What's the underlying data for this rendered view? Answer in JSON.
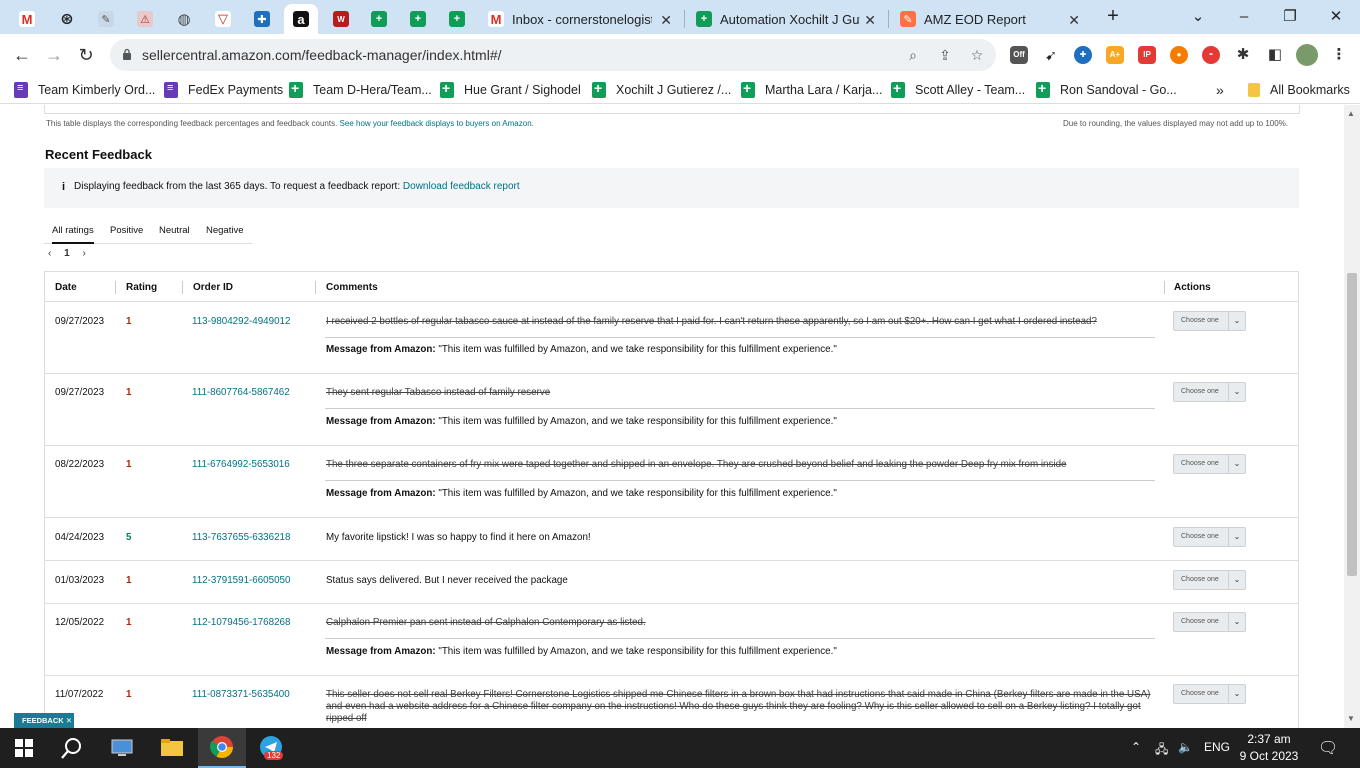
{
  "browser": {
    "tabs": [
      {
        "title": "Inbox - cornerstonelogisti"
      },
      {
        "title": "Automation Xochilt J Gutie"
      },
      {
        "title": "AMZ EOD Report"
      }
    ],
    "url": "sellercentral.amazon.com/feedback-manager/index.html#/",
    "new_tab": "+",
    "win_min": "–",
    "win_max": "❐",
    "win_close": "✕",
    "chevron": "⌄",
    "ext_off_label": "Off"
  },
  "bookmarks": {
    "items": [
      {
        "label": "Team Kimberly Ord..."
      },
      {
        "label": "FedEx Payments"
      },
      {
        "label": "Team D-Hera/Team..."
      },
      {
        "label": "Hue Grant / Sighodel"
      },
      {
        "label": "Xochilt J Gutierez /..."
      },
      {
        "label": "Martha Lara / Karja..."
      },
      {
        "label": "Scott Alley - Team..."
      },
      {
        "label": "Ron Sandoval - Go..."
      }
    ],
    "more": "»",
    "all_bookmarks": "All Bookmarks"
  },
  "page": {
    "table_note": "This table displays the corresponding feedback percentages and feedback counts.",
    "table_note_link": "See how your feedback displays to buyers on Amazon.",
    "rounding_note": "Due to rounding, the values displayed may not add up to 100%.",
    "section_title": "Recent Feedback",
    "info_icon": "i",
    "info_text": "Displaying feedback from the last 365 days. To request a feedback report:",
    "info_link": "Download feedback report",
    "rating_tabs": [
      "All ratings",
      "Positive",
      "Neutral",
      "Negative"
    ],
    "pager": {
      "prev": "‹",
      "page": "1",
      "next": "›"
    },
    "columns": [
      "Date",
      "Rating",
      "Order ID",
      "Comments",
      "Actions"
    ],
    "message_prefix": "Message from Amazon:",
    "message_text": "\"This item was fulfilled by Amazon, and we take responsibility for this fulfillment experience.\"",
    "action_label": "Choose one",
    "rows": [
      {
        "date": "09/27/2023",
        "rating": "1",
        "order": "113-9804292-4949012",
        "comment": "I received 2 bottles of regular tabasco sauce at instead of the family reserve that I paid for. I can't return these apparently, so I am out $20+. How can I get what I ordered instead?"
      },
      {
        "date": "09/27/2023",
        "rating": "1",
        "order": "111-8607764-5867462",
        "comment": "They sent regular Tabasco instead of family reserve"
      },
      {
        "date": "08/22/2023",
        "rating": "1",
        "order": "111-6764992-5653016",
        "comment": "The three separate containers of fry mix were taped together and shipped in an envelope. They are crushed beyond belief and leaking the powder Deep fry mix from inside"
      },
      {
        "date": "04/24/2023",
        "rating": "5",
        "order": "113-7637655-6336218",
        "comment": "My favorite lipstick! I was so happy to find it here on Amazon!"
      },
      {
        "date": "01/03/2023",
        "rating": "1",
        "order": "112-3791591-6605050",
        "comment": "Status says delivered. But I never received the package"
      },
      {
        "date": "12/05/2022",
        "rating": "1",
        "order": "112-1079456-1768268",
        "comment": "Calphalon Premier pan sent instead of Calphalon Contemporary as listed."
      },
      {
        "date": "11/07/2022",
        "rating": "1",
        "order": "111-0873371-5635400",
        "comment": "This seller does not sell real Berkey Filters! Cornerstone Logistics shipped me Chinese filters in a brown box that had instructions that said made in China (Berkey filters are made in the USA) and even had a website address for a Chinese filter company on the instructions! Who do these guys think they are fooling? Why is this seller allowed to sell on a Berkey listing? I totally got ripped off"
      }
    ],
    "feedback_badge": "FEEDBACK ✕"
  },
  "taskbar": {
    "language": "ENG",
    "time": "2:37 am",
    "date": "9 Oct 2023",
    "telegram_badge": "132"
  }
}
